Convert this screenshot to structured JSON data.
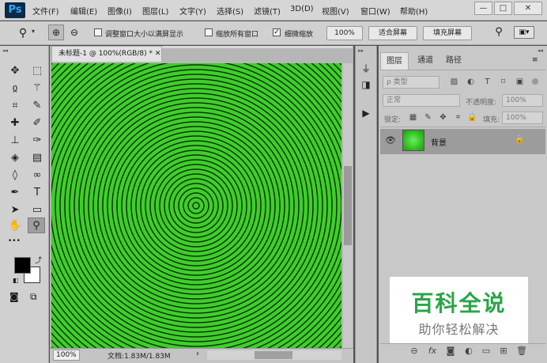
{
  "app": {
    "logo": "Ps",
    "menu": [
      "文件(F)",
      "编辑(E)",
      "图像(I)",
      "图层(L)",
      "文字(Y)",
      "选择(S)",
      "滤镜(T)",
      "3D(D)",
      "视图(V)",
      "窗口(W)",
      "帮助(H)"
    ],
    "window_controls": {
      "minimize": "—",
      "restore": "□",
      "close": "✕"
    }
  },
  "options": {
    "resize_windows_label": "调整窗口大小以满屏显示",
    "resize_windows_checked": false,
    "zoom_all_label": "缩放所有窗口",
    "zoom_all_checked": false,
    "scrubby_label": "细微缩放",
    "scrubby_checked": true,
    "zoom_value": "100%",
    "fit_screen_label": "适合屏幕",
    "fill_screen_label": "填充屏幕"
  },
  "document": {
    "tab_title": "未标题-1 @ 100%(RGB/8) *",
    "close_glyph": "✕",
    "zoom": "100%",
    "info": "文档:1.83M/1.83M",
    "info_arrow": "›",
    "colors": {
      "ring_fill": "#3ecf2a",
      "ring_line": "#0e2a0a"
    }
  },
  "tools": {
    "foreground": "#000000",
    "background": "#ffffff",
    "more_glyph": "•••"
  },
  "layers_panel": {
    "tabs": [
      "图层",
      "通道",
      "路径"
    ],
    "filter_label": "ρ 类型",
    "blend_mode": "正常",
    "opacity_label": "不透明度:",
    "opacity_value": "100%",
    "lock_label": "锁定:",
    "fill_label": "填充:",
    "fill_value": "100%",
    "layers": [
      {
        "name": "背景",
        "visible": true,
        "locked": true
      }
    ]
  },
  "watermark": {
    "title": "百科全说",
    "subtitle": "助你轻松解决"
  }
}
